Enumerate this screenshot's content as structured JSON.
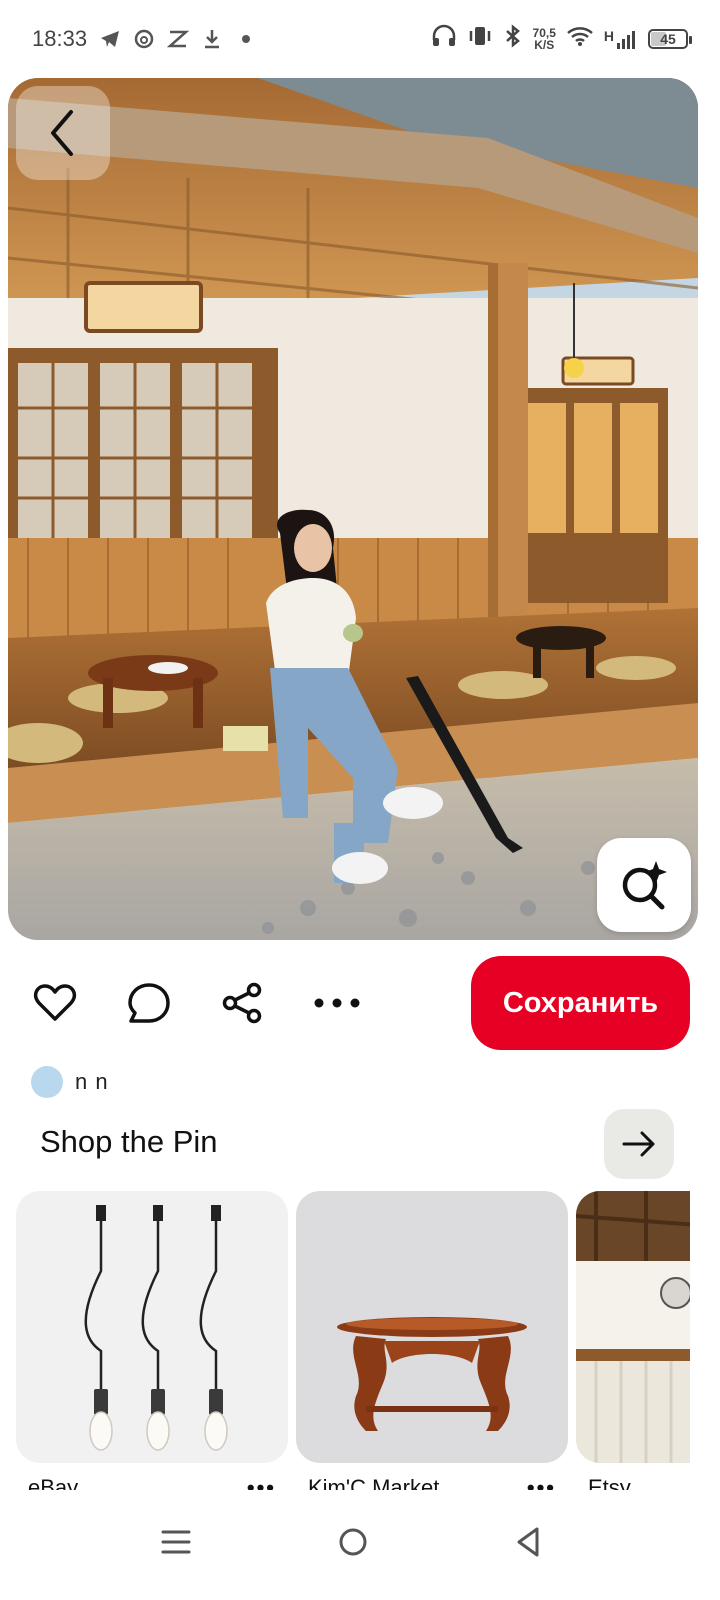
{
  "status_bar": {
    "time": "18:33",
    "left_icons": [
      "telegram-icon",
      "threads-icon",
      "capcut-icon",
      "download-icon",
      "dot-icon"
    ],
    "speed_value": "70,5",
    "speed_unit": "K/S",
    "network": "H",
    "battery": "45",
    "battery_level": 0.45
  },
  "pin": {
    "image_subject": "woman-sitting-on-wooden-hanok-porch"
  },
  "actions": {
    "save_label": "Сохранить"
  },
  "author": {
    "name": "n n",
    "avatar_color": "#b9d8ee"
  },
  "shop": {
    "title": "Shop the Pin",
    "products": [
      {
        "store": "eBay",
        "more": "•••",
        "image": "pendant-lamps"
      },
      {
        "store": "Kim'C Market",
        "more": "•••",
        "image": "wooden-tray-table"
      },
      {
        "store": "Etsy",
        "more": "",
        "image": "hanok-interior"
      }
    ]
  },
  "colors": {
    "save_button": "#e60023",
    "arrow_button_bg": "#e9e9e6"
  }
}
